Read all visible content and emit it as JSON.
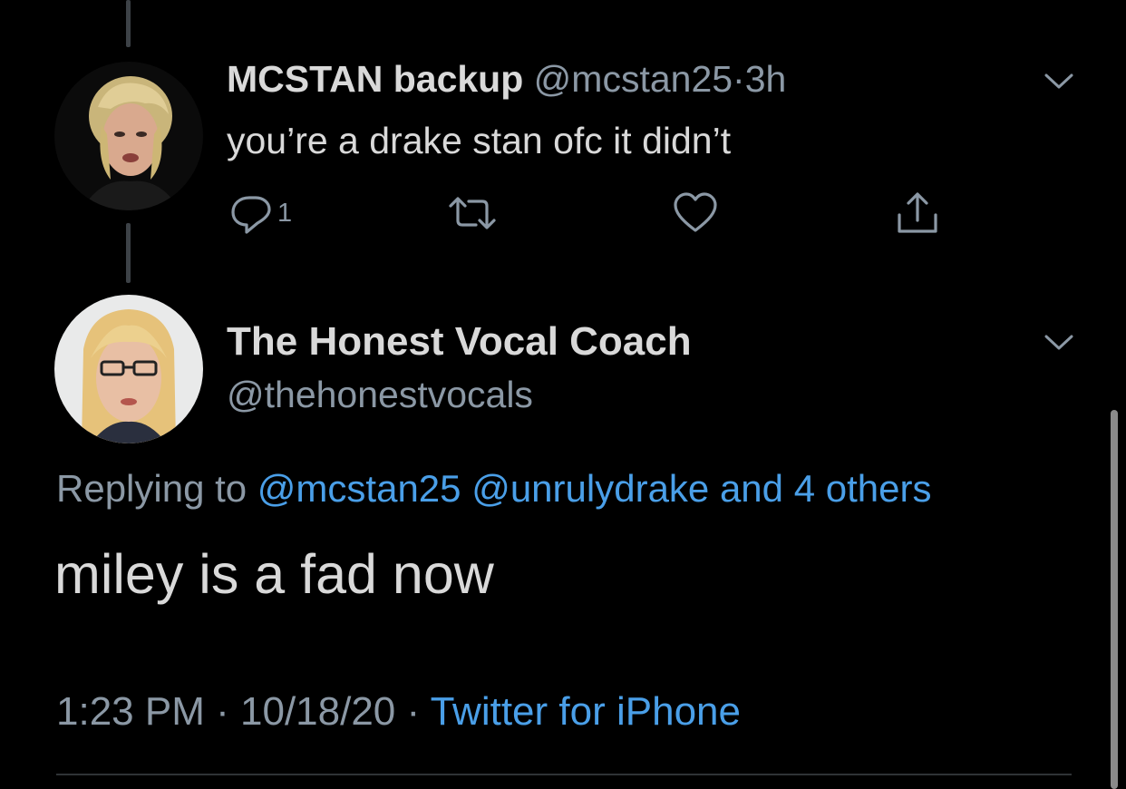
{
  "parent_tweet": {
    "display_name": "MCSTAN backup",
    "handle": "@mcstan25",
    "separator": "·",
    "time": "3h",
    "text": "you’re a drake stan ofc it didn’t",
    "actions": {
      "reply_icon": "reply-icon",
      "reply_count": "1",
      "retweet_icon": "retweet-icon",
      "like_icon": "heart-icon",
      "share_icon": "share-icon"
    }
  },
  "main_tweet": {
    "display_name": "The Honest Vocal Coach",
    "handle": "@thehonestvocals",
    "replying_prefix": "Replying to",
    "replying_mentions": "@mcstan25 @unrulydrake and 4 others",
    "text": "miley is a fad now",
    "time": "1:23 PM",
    "separator": "·",
    "date": "10/18/20",
    "source": "Twitter for iPhone"
  },
  "colors": {
    "background": "#000000",
    "primary_text": "#d9d9d9",
    "secondary_text": "#8b98a5",
    "link": "#4a9fe8",
    "divider": "#2f3336"
  }
}
